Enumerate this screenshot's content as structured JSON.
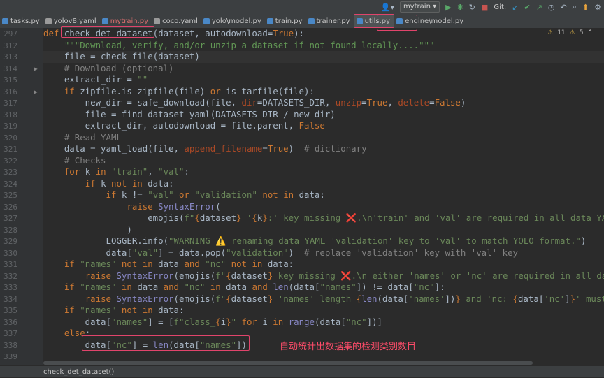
{
  "toolbar": {
    "run_config": "mytrain",
    "git_label": "Git:"
  },
  "tabs": [
    {
      "label": "tasks.py",
      "modified": false,
      "active": false,
      "icon_color": "#4a88c7"
    },
    {
      "label": "yolov8.yaml",
      "modified": false,
      "active": false,
      "icon_color": "#9a9a9a"
    },
    {
      "label": "mytrain.py",
      "modified": true,
      "active": false,
      "icon_color": "#4a88c7"
    },
    {
      "label": "coco.yaml",
      "modified": false,
      "active": false,
      "icon_color": "#9a9a9a"
    },
    {
      "label": "yolo\\model.py",
      "modified": false,
      "active": false,
      "icon_color": "#4a88c7"
    },
    {
      "label": "train.py",
      "modified": false,
      "active": false,
      "icon_color": "#4a88c7"
    },
    {
      "label": "trainer.py",
      "modified": false,
      "active": false,
      "icon_color": "#4a88c7"
    },
    {
      "label": "utils.py",
      "modified": false,
      "active": true,
      "icon_color": "#4a88c7"
    },
    {
      "label": "engine\\model.py",
      "modified": false,
      "active": false,
      "icon_color": "#4a88c7"
    }
  ],
  "inspections": {
    "warnings": "11",
    "weak_warnings": "5"
  },
  "line_numbers": [
    "297",
    "312",
    "313",
    "314",
    "315",
    "316",
    "317",
    "318",
    "319",
    "320",
    "321",
    "322",
    "323",
    "324",
    "325",
    "326",
    "327",
    "328",
    "329",
    "330",
    "331",
    "332",
    "333",
    "334",
    "335",
    "336",
    "337",
    "338",
    "339"
  ],
  "code_lines": [
    "<k>def </k>check_det_dataset(dataset, autodownload=<k>True</k>):",
    "    <d>\"\"\"Download, verify, and/or unzip a dataset if not found locally....\"\"\"</d>",
    "    file = check_file(dataset)",
    "    <c># Download (optional)</c>",
    "    extract_dir = <s>\"\"</s>",
    "    <k>if </k>zipfile.is_zipfile(file) <k>or </k>is_tarfile(file):",
    "        new_dir = safe_download(file, <p>dir</p>=DATASETS_DIR, <p>unzip</p>=<k>True</k>, <p>delete</p>=<k>False</k>)",
    "        file = find_dataset_yaml(DATASETS_DIR / new_dir)",
    "        extract_dir, autodownload = file.parent, <k>False</k>",
    "    <c># Read YAML</c>",
    "    data = yaml_load(file, <p>append_filename</p>=<k>True</k>)  <c># dictionary</c>",
    "    <c># Checks</c>",
    "    <k>for </k>k <k>in </k><s>\"train\"</s>, <s>\"val\"</s>:",
    "        <k>if </k>k <k>not in </k>data:",
    "            <k>if </k>k != <s>\"val\" </s><k>or </k><s>\"validation\" </s><k>not in </k>data:",
    "                <k>raise </k><b>SyntaxError</b>(",
    "                    emojis(<s>f\"</s><k>{</k>dataset<k>}</k><s> '</s><k>{</k>k<k>}</k><s>:' key missing ❌.\\n'train' and 'val' are required in all data YAML</s>",
    "                )",
    "            LOGGER.info(<s>\"WARNING ⚠️ renaming data YAML 'validation' key to 'val' to match YOLO format.\"</s>)",
    "            data[<s>\"val\"</s>] = data.pop(<s>\"validation\"</s>)  <c># replace 'validation' key with 'val' key</c>",
    "    <k>if </k><s>\"names\" </s><k>not in </k>data <k>and </k><s>\"nc\" </s><k>not in </k>data:",
    "        <k>raise </k><b>SyntaxError</b>(emojis(<s>f\"</s><k>{</k>dataset<k>}</k><s> key missing ❌.\\n either 'names' or 'nc' are required in all dat</s>",
    "    <k>if </k><s>\"names\" </s><k>in </k>data <k>and </k><s>\"nc\" </s><k>in </k>data <k>and </k><b>len</b>(data[<s>\"names\"</s>]) != data[<s>\"nc\"</s>]:",
    "        <k>raise </k><b>SyntaxError</b>(emojis(<s>f\"</s><k>{</k>dataset<k>}</k><s> 'names' length </s><k>{</k><b>len</b>(data[<s>'names'</s>])<k>}</k><s> and 'nc: </s><k>{</k>data[<s>'nc'</s>]<k>}</k><s>' must</s>",
    "    <k>if </k><s>\"names\" </s><k>not in </k>data:",
    "        data[<s>\"names\"</s>] = [<s>f\"class_</s><k>{</k>i<k>}</k><s>\" </s><k>for </k>i <k>in </k><b>range</b>(data[<s>\"nc\"</s>])]",
    "    <k>else</k>:",
    "        data[<s>\"nc\"</s>] = <b>len</b>(data[<s>\"names\"</s>])",
    ""
  ],
  "partial_line": "    data[\"names\"] = check_class_names(data[\"names\"])",
  "annotation": "自动统计出数据集的检测类别数目",
  "status_bar": "check_det_dataset()"
}
